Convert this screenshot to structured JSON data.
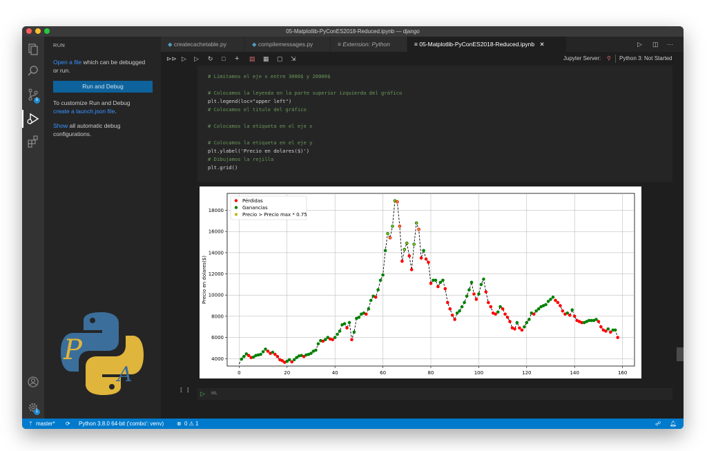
{
  "window": {
    "title": "05-Matplotlib-PyConES2018-Reduced.ipynb — django"
  },
  "sidebar": {
    "header": "RUN",
    "open_file_link": "Open a file",
    "open_file_rest": " which can be debugged",
    "open_file_rest2": "or run.",
    "run_button": "Run and Debug",
    "customize_line1": "To customize Run and Debug",
    "launch_link": "create a launch.json file",
    "launch_tail": ".",
    "show_link": "Show",
    "show_rest": " all automatic debug",
    "show_rest2": "configurations."
  },
  "tabs": [
    {
      "label": "createcachetable.py",
      "icon": "python-file-icon"
    },
    {
      "label": "compilemessages.py",
      "icon": "python-file-icon"
    },
    {
      "label": "Extension: Python",
      "icon": "extension-icon"
    },
    {
      "label": "05-Matplotlib-PyConES2018-Reduced.ipynb",
      "icon": "notebook-icon",
      "active": true
    }
  ],
  "toolbar": {
    "jupyter_server_label": "Jupyter Server:",
    "kernel_label": "Python 3: Not Started"
  },
  "code_lines": [
    {
      "text": "# Limitamos el eje x entre 3000$ y 20000$",
      "kind": "comment"
    },
    {
      "text": "",
      "kind": "code"
    },
    {
      "text": "# Colocamos la leyenda en la parte superior izquierda del gráfico",
      "kind": "comment"
    },
    {
      "text": "plt.legend(loc=\"upper left\")",
      "kind": "code"
    },
    {
      "text": "# Colocamos el título del gráfico",
      "kind": "comment"
    },
    {
      "text": "",
      "kind": "code"
    },
    {
      "text": "# Colocamos la etiqueta en el eje x",
      "kind": "comment"
    },
    {
      "text": "",
      "kind": "code"
    },
    {
      "text": "# Colocamos la etiqueta en el eje y",
      "kind": "comment"
    },
    {
      "text": "plt.ylabel('Precio en dolares($)')",
      "kind": "code"
    },
    {
      "text": "# Dibujamos la rejilla",
      "kind": "comment"
    },
    {
      "text": "plt.grid()",
      "kind": "code"
    }
  ],
  "empty_cell": {
    "prompt": "[ ]",
    "language": "ML"
  },
  "statusbar": {
    "branch": "master*",
    "interpreter": "Python 3.8.0 64-bit ('combo': venv)",
    "problems": "0 ⚠ 1"
  },
  "colors": {
    "losses": "#ff0000",
    "gains": "#008000",
    "high": "#bcbd22",
    "accent": "#007acc"
  },
  "chart_data": {
    "type": "scatter",
    "ylabel": "Precio en dolares($)",
    "xlabel": "",
    "title": "",
    "xlim": [
      -5,
      165
    ],
    "ylim": [
      3300,
      19600
    ],
    "xticks": [
      0,
      20,
      40,
      60,
      80,
      100,
      120,
      140,
      160
    ],
    "yticks": [
      4000,
      6000,
      8000,
      10000,
      12000,
      14000,
      16000,
      18000
    ],
    "grid": true,
    "legend_position": "upper left",
    "legend": [
      "Pérdidas",
      "Ganancias",
      "Precio > Precio max * 0.75"
    ],
    "high_threshold": 14250,
    "line_style": "dashed black",
    "y": [
      3500,
      3950,
      4200,
      4450,
      4300,
      4100,
      4150,
      4300,
      4350,
      4400,
      4650,
      4900,
      4700,
      4500,
      4600,
      4400,
      4200,
      3900,
      3800,
      3650,
      3750,
      3900,
      3700,
      3900,
      4100,
      4250,
      4300,
      4200,
      4350,
      4400,
      4500,
      4700,
      4800,
      5400,
      5700,
      5650,
      5800,
      6000,
      5850,
      5800,
      6000,
      6300,
      6600,
      7200,
      7300,
      6900,
      7400,
      5800,
      6500,
      7800,
      7900,
      8200,
      8300,
      8200,
      8700,
      9500,
      9900,
      9800,
      10500,
      11400,
      11900,
      14200,
      15800,
      15400,
      16500,
      18900,
      18800,
      16500,
      13200,
      14300,
      14900,
      13700,
      12400,
      14800,
      16800,
      16200,
      13500,
      14200,
      13400,
      13100,
      11100,
      11400,
      11400,
      10800,
      11200,
      11400,
      10600,
      9300,
      8700,
      8100,
      7700,
      8300,
      8500,
      8900,
      9300,
      9900,
      10500,
      11200,
      10100,
      9600,
      10100,
      11000,
      11500,
      10300,
      9300,
      8900,
      8300,
      8200,
      8400,
      8900,
      8700,
      8200,
      7900,
      7500,
      6900,
      6800,
      7400,
      6900,
      6700,
      7000,
      7400,
      7700,
      8300,
      8200,
      8500,
      8700,
      8900,
      9000,
      9100,
      9400,
      9600,
      9800,
      9500,
      9300,
      9000,
      8500,
      8200,
      8300,
      8100,
      8600,
      8000,
      7600,
      7500,
      7400,
      7400,
      7500,
      7600,
      7600,
      7600,
      7700,
      7500,
      7000,
      6700,
      6600,
      6800,
      6500,
      6700,
      6700,
      6000
    ]
  }
}
